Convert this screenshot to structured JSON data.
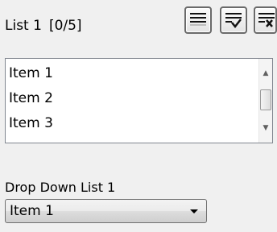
{
  "list": {
    "title": "List 1",
    "count": "[0/5]",
    "items": [
      "Item 1",
      "Item 2",
      "Item 3"
    ]
  },
  "toolbar": {
    "buttons": [
      {
        "icon": "list-lines-icon"
      },
      {
        "icon": "list-check-icon"
      },
      {
        "icon": "list-clear-icon"
      }
    ]
  },
  "dropdown": {
    "label": "Drop Down List 1",
    "value": "Item 1"
  },
  "scrollbar": {
    "up_glyph": "▲",
    "down_glyph": "▼"
  }
}
